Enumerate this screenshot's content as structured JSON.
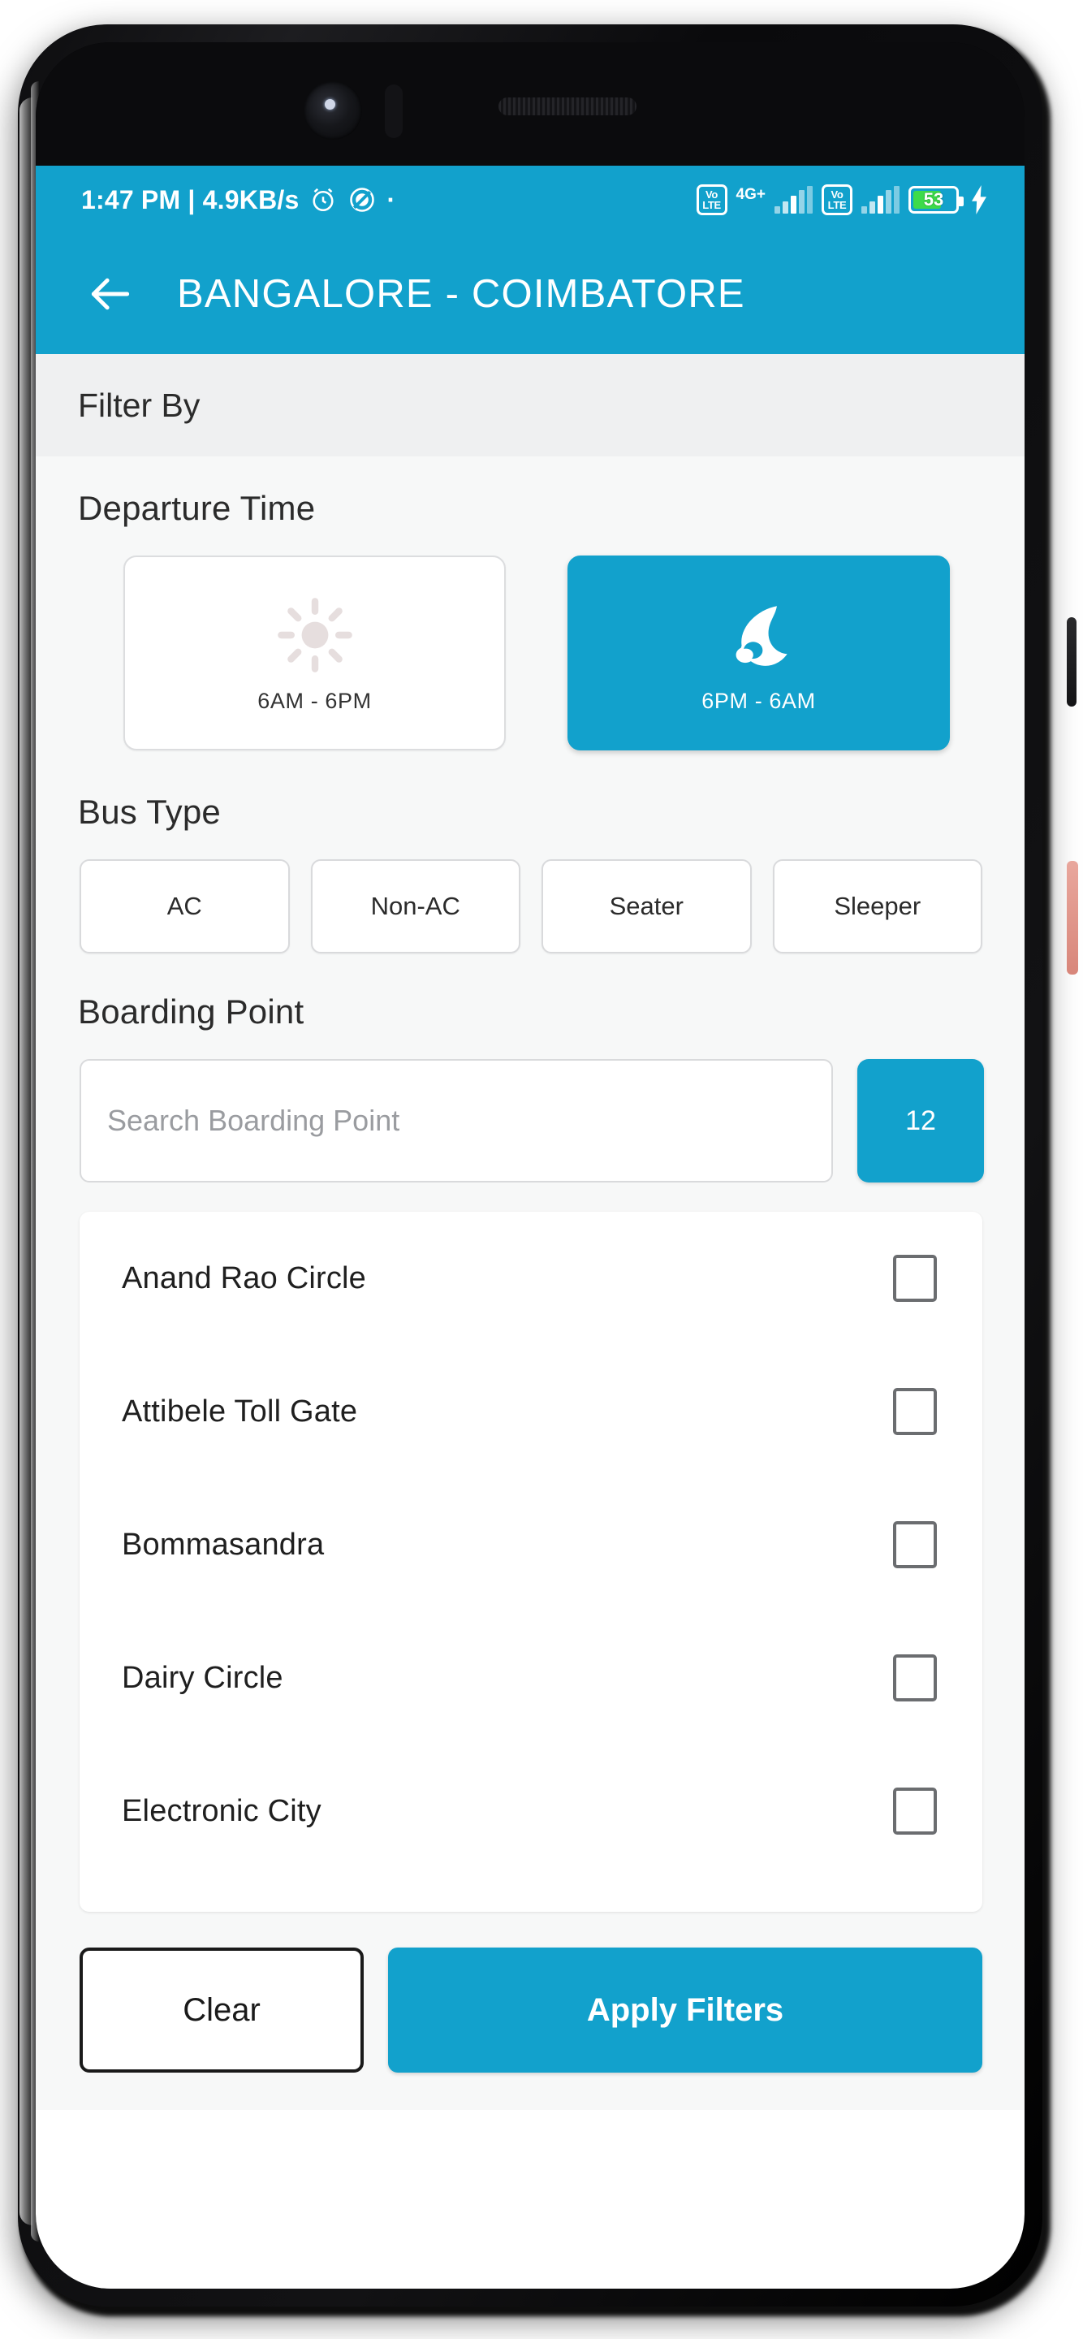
{
  "status_bar": {
    "time_and_speed": "1:47 PM | 4.9KB/s",
    "alarm_icon": "alarm-clock-icon",
    "dnd_icon": "do-not-disturb-icon",
    "dot": "·",
    "sim1_volte": "VoLTE",
    "sim1_volte_top": "Vo",
    "sim1_volte_bottom": "LTE",
    "network_type": "4G+",
    "sim2_volte_top": "Vo",
    "sim2_volte_bottom": "LTE",
    "battery_percent": "53",
    "charging_icon": "charging-bolt-icon"
  },
  "app_bar": {
    "back_icon": "back-arrow-icon",
    "title": "BANGALORE - COIMBATORE"
  },
  "filter_bar": {
    "label": "Filter By"
  },
  "departure_time": {
    "section_title": "Departure Time",
    "options": [
      {
        "label": "6AM - 6PM",
        "icon": "sun-icon",
        "selected": false
      },
      {
        "label": "6PM - 6AM",
        "icon": "moon-cloud-icon",
        "selected": true
      }
    ]
  },
  "bus_type": {
    "section_title": "Bus Type",
    "options": [
      {
        "label": "AC",
        "selected": false
      },
      {
        "label": "Non-AC",
        "selected": false
      },
      {
        "label": "Seater",
        "selected": false
      },
      {
        "label": "Sleeper",
        "selected": false
      }
    ]
  },
  "boarding_point": {
    "section_title": "Boarding Point",
    "search_placeholder": "Search Boarding Point",
    "search_value": "",
    "count_badge": "12",
    "items": [
      {
        "name": "Anand Rao Circle",
        "checked": false
      },
      {
        "name": "Attibele Toll Gate",
        "checked": false
      },
      {
        "name": "Bommasandra",
        "checked": false
      },
      {
        "name": "Dairy Circle",
        "checked": false
      },
      {
        "name": "Electronic City",
        "checked": false
      }
    ]
  },
  "footer": {
    "clear_label": "Clear",
    "apply_label": "Apply Filters"
  },
  "colors": {
    "accent": "#12a1cc",
    "page_background": "#f7f8f8",
    "filter_bar_background": "#eff0f1",
    "battery_fill": "#3ddb4a",
    "text_primary": "#2b2b2b"
  }
}
